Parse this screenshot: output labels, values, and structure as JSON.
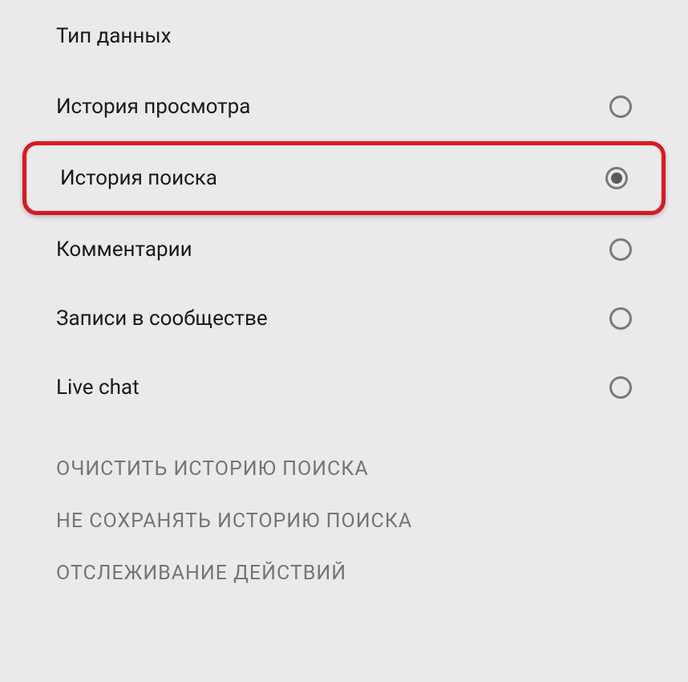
{
  "section_title": "Тип данных",
  "options": [
    {
      "label": "История просмотра",
      "selected": false,
      "highlighted": false
    },
    {
      "label": "История поиска",
      "selected": true,
      "highlighted": true
    },
    {
      "label": "Комментарии",
      "selected": false,
      "highlighted": false
    },
    {
      "label": "Записи в сообществе",
      "selected": false,
      "highlighted": false
    },
    {
      "label": "Live chat",
      "selected": false,
      "highlighted": false
    }
  ],
  "actions": [
    "ОЧИСТИТЬ ИСТОРИЮ ПОИСКА",
    "НЕ СОХРАНЯТЬ ИСТОРИЮ ПОИСКА",
    "ОТСЛЕЖИВАНИЕ ДЕЙСТВИЙ"
  ]
}
